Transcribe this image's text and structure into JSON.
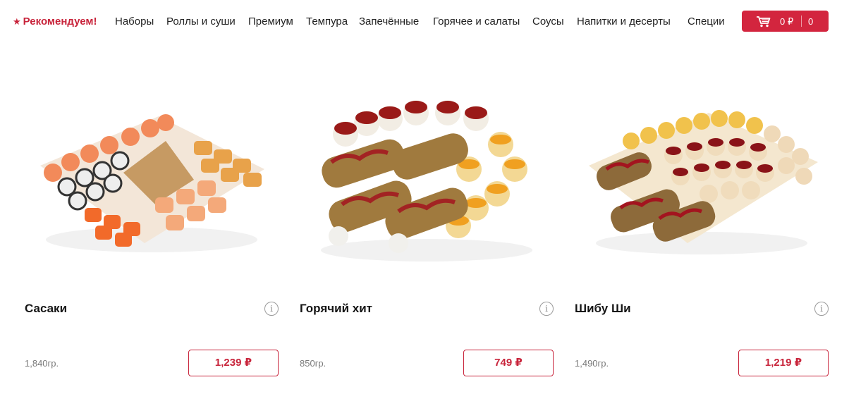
{
  "nav": {
    "items": [
      {
        "label": "Рекомендуем!",
        "active": true
      },
      {
        "label": "Наборы"
      },
      {
        "label": "Роллы и суши"
      },
      {
        "label": "Премиум"
      },
      {
        "label": "Темпура"
      },
      {
        "label": "Запечённые"
      },
      {
        "label": "Горячее и салаты"
      },
      {
        "label": "Соусы"
      },
      {
        "label": "Напитки и десерты"
      },
      {
        "label": "Специи"
      }
    ],
    "star_icon": "star-icon"
  },
  "cart": {
    "sum": "0 ₽",
    "count": "0",
    "icon": "cart-icon",
    "color": "#d3253e"
  },
  "products": [
    {
      "name": "Сасаки",
      "weight": "1,840гр.",
      "price": "1,239 ₽",
      "image": "sushi-set-photo"
    },
    {
      "name": "Горячий хит",
      "weight": "850гр.",
      "price": "749 ₽",
      "image": "hot-rolls-set-photo"
    },
    {
      "name": "Шибу Ши",
      "weight": "1,490гр.",
      "price": "1,219 ₽",
      "image": "baked-rolls-set-photo"
    }
  ],
  "info_icon_glyph": "i",
  "accent_color": "#c8243b"
}
